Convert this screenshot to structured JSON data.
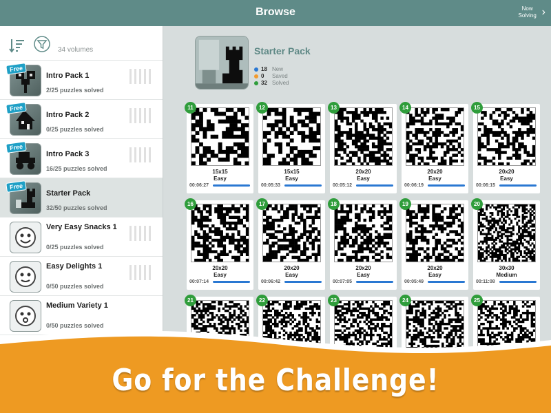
{
  "header": {
    "title": "Browse",
    "now_solving": "Now Solving"
  },
  "sidebar": {
    "volume_count": "34 volumes",
    "packs": [
      {
        "name": "Intro Pack 1",
        "solved": "2/25 puzzles solved",
        "free": "Free"
      },
      {
        "name": "Intro Pack 2",
        "solved": "0/25 puzzles solved",
        "free": "Free"
      },
      {
        "name": "Intro Pack 3",
        "solved": "16/25 puzzles solved",
        "free": "Free"
      },
      {
        "name": "Starter Pack",
        "solved": "32/50 puzzles solved",
        "free": "Free"
      },
      {
        "name": "Very Easy Snacks 1",
        "solved": "0/25 puzzles solved"
      },
      {
        "name": "Easy Delights 1",
        "solved": "0/50 puzzles solved"
      },
      {
        "name": "Medium Variety 1",
        "solved": "0/50 puzzles solved"
      }
    ]
  },
  "main": {
    "pack_title": "Starter Pack",
    "legend": [
      {
        "count": "18",
        "label": "New",
        "color": "#2a78d2"
      },
      {
        "count": "0",
        "label": "Saved",
        "color": "#f29a2e"
      },
      {
        "count": "32",
        "label": "Solved",
        "color": "#2f9d3b"
      }
    ],
    "puzzles": [
      {
        "num": "11",
        "size": "15x15",
        "difficulty": "Easy",
        "time": "00:06:27"
      },
      {
        "num": "12",
        "size": "15x15",
        "difficulty": "Easy",
        "time": "00:05:33"
      },
      {
        "num": "13",
        "size": "20x20",
        "difficulty": "Easy",
        "time": "00:05:12"
      },
      {
        "num": "14",
        "size": "20x20",
        "difficulty": "Easy",
        "time": "00:06:19"
      },
      {
        "num": "15",
        "size": "20x20",
        "difficulty": "Easy",
        "time": "00:06:15"
      },
      {
        "num": "16",
        "size": "20x20",
        "difficulty": "Easy",
        "time": "00:07:14"
      },
      {
        "num": "17",
        "size": "20x20",
        "difficulty": "Easy",
        "time": "00:06:42"
      },
      {
        "num": "18",
        "size": "20x20",
        "difficulty": "Easy",
        "time": "00:07:05"
      },
      {
        "num": "19",
        "size": "20x20",
        "difficulty": "Easy",
        "time": "00:05:49"
      },
      {
        "num": "20",
        "size": "30x30",
        "difficulty": "Medium",
        "time": "00:11:08"
      },
      {
        "num": "21"
      },
      {
        "num": "22"
      },
      {
        "num": "23"
      },
      {
        "num": "24"
      },
      {
        "num": "25"
      }
    ]
  },
  "banner": {
    "text": "Go for the Challenge!",
    "color": "#ee9a22"
  },
  "colors": {
    "topbar": "#5f8b88",
    "accent": "#5e8885",
    "progress": "#2a78d2",
    "solved_badge": "#2f9d3b"
  }
}
